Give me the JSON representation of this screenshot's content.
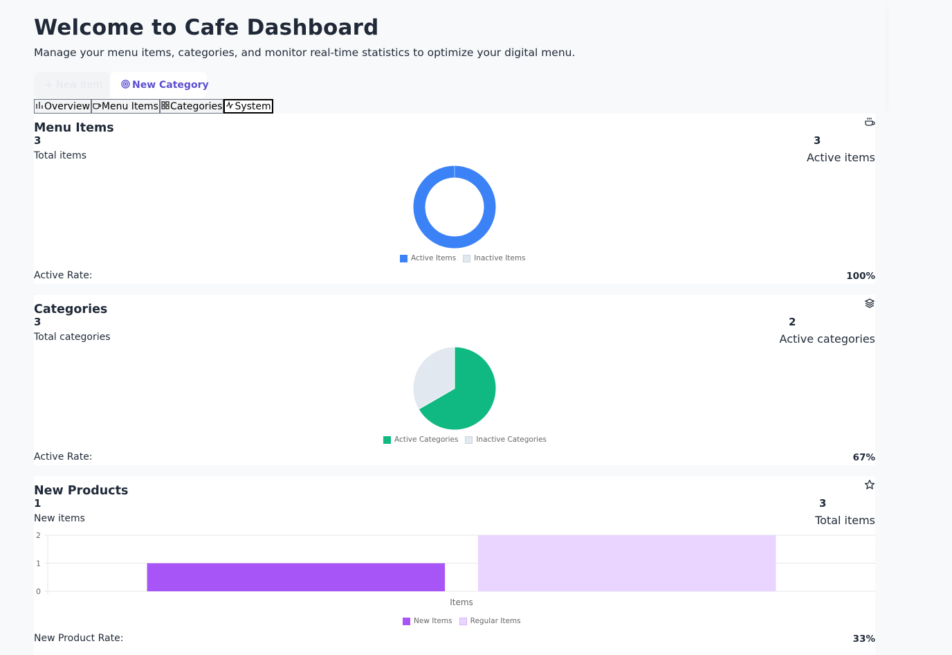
{
  "header": {
    "title": "Welcome to Cafe Dashboard",
    "subtitle": "Manage your menu items, categories, and monitor real-time statistics to optimize your digital menu.",
    "new_item_label": "+ New Item",
    "new_category_label": "New Category"
  },
  "tabs": [
    {
      "label": "Overview",
      "icon": "bar-chart-icon"
    },
    {
      "label": "Menu Items",
      "icon": "coffee-icon"
    },
    {
      "label": "Categories",
      "icon": "grid-icon"
    },
    {
      "label": "System",
      "icon": "activity-icon",
      "active": true
    }
  ],
  "menu_items": {
    "title": "Menu Items",
    "icon": "coffee-cup-icon",
    "total_value": "3",
    "total_label": "Total items",
    "active_value": "3",
    "active_label": "Active items",
    "rate_label": "Active Rate:",
    "rate_value": "100%"
  },
  "categories": {
    "title": "Categories",
    "icon": "layers-icon",
    "total_value": "3",
    "total_label": "Total categories",
    "active_value": "2",
    "active_label": "Active categories",
    "rate_label": "Active Rate:",
    "rate_value": "67%"
  },
  "new_products": {
    "title": "New Products",
    "icon": "star-icon",
    "new_value": "1",
    "new_label": "New items",
    "total_value": "3",
    "total_label": "Total items",
    "rate_label": "New Product Rate:",
    "rate_value": "33%"
  },
  "colors": {
    "accent": "#5b4fd1",
    "blue": "#3b82f6",
    "green": "#10b981",
    "purple": "#a855f7",
    "light_purple": "#e9d5ff",
    "gray": "#e2e8f0"
  },
  "chart_data": [
    {
      "type": "pie",
      "variant": "doughnut",
      "labels": [
        "Active Items",
        "Inactive Items"
      ],
      "values": [
        3,
        0
      ],
      "colors": [
        "#3b82f6",
        "#e2e8f0"
      ],
      "legend": "bottom"
    },
    {
      "type": "pie",
      "labels": [
        "Active Categories",
        "Inactive Categories"
      ],
      "values": [
        2,
        1
      ],
      "colors": [
        "#10b981",
        "#e2e8f0"
      ],
      "legend": "bottom"
    },
    {
      "type": "bar",
      "categories": [
        "Items"
      ],
      "xlabel": "Items",
      "series": [
        {
          "name": "New Items",
          "values": [
            1
          ],
          "color": "#a855f7"
        },
        {
          "name": "Regular Items",
          "values": [
            2
          ],
          "color": "#e9d5ff"
        }
      ],
      "ylim": [
        0,
        2
      ],
      "yticks": [
        "0",
        "1",
        "2"
      ],
      "grid": true,
      "legend": "bottom"
    }
  ]
}
